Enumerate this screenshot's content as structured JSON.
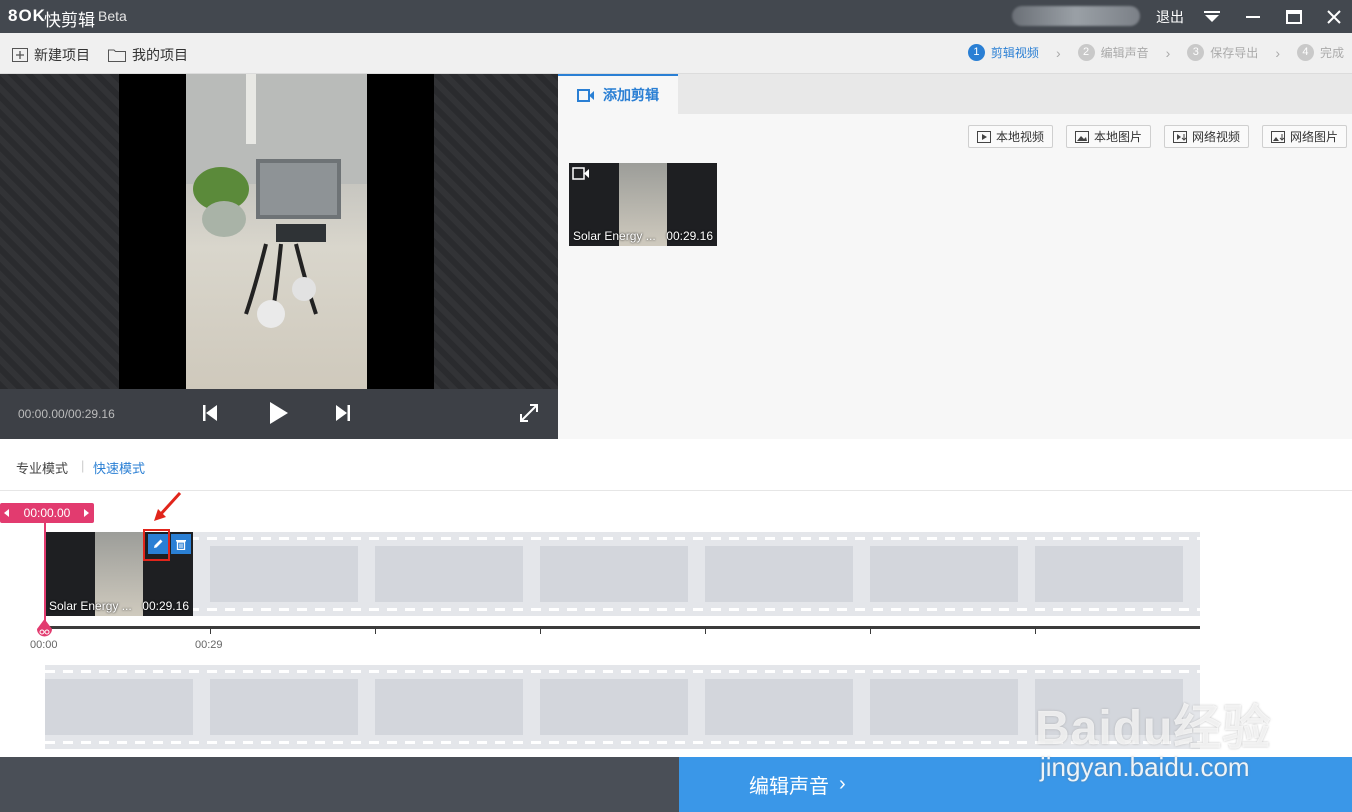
{
  "app": {
    "logo_icon_text": "8OK",
    "name": "快剪辑",
    "edition": "Beta"
  },
  "titlebar": {
    "logout": "退出"
  },
  "toolbar": {
    "new_project": "新建项目",
    "my_projects": "我的项目"
  },
  "steps": [
    {
      "num": "1",
      "label": "剪辑视频",
      "active": true
    },
    {
      "num": "2",
      "label": "编辑声音",
      "active": false
    },
    {
      "num": "3",
      "label": "保存导出",
      "active": false
    },
    {
      "num": "4",
      "label": "完成",
      "active": false
    }
  ],
  "player": {
    "time": "00:00.00/00:29.16"
  },
  "right_panel": {
    "tab": "添加剪辑",
    "buttons": [
      "本地视频",
      "本地图片",
      "网络视频",
      "网络图片"
    ],
    "clip": {
      "title": "Solar Energy ...",
      "duration": "00:29.16"
    }
  },
  "modes": {
    "pro": "专业模式",
    "separator": "|",
    "quick": "快速模式"
  },
  "timeline": {
    "playhead": "00:00.00",
    "clip": {
      "title": "Solar Energy ...",
      "duration": "00:29.16"
    },
    "ticks": [
      "00:00",
      "00:29"
    ]
  },
  "bottom": {
    "next_button": "编辑声音"
  },
  "watermark": {
    "brand": "Baidu经验",
    "url": "jingyan.baidu.com"
  },
  "colors": {
    "accent": "#2a7fd4",
    "playhead": "#e23b6f",
    "highlight": "#e1251b"
  }
}
